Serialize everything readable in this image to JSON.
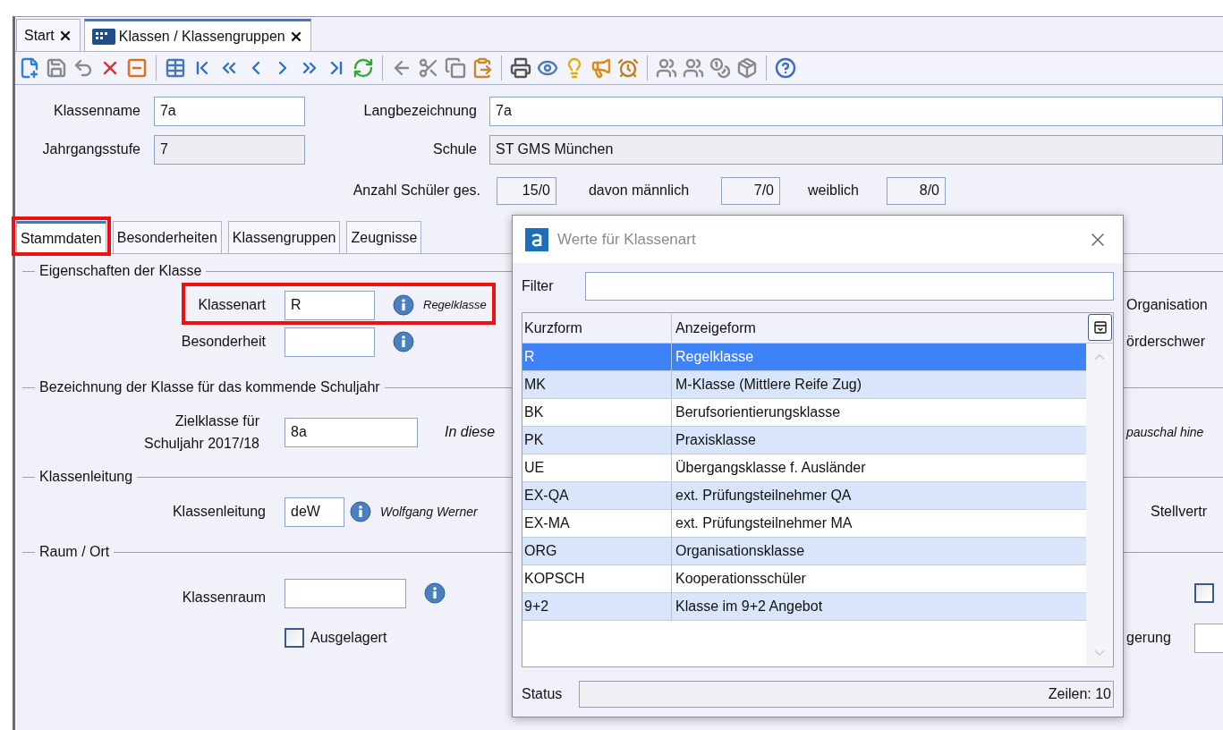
{
  "tabs": [
    {
      "label": "Start",
      "selected": false
    },
    {
      "label": "Klassen / Klassengruppen",
      "selected": true
    }
  ],
  "header_fields": [
    {
      "label": "Klassenname",
      "value": "7a",
      "readonly": false
    },
    {
      "label": "Langbezeichnung",
      "value": "7a",
      "readonly": false
    },
    {
      "label": "Jahrgangsstufe",
      "value": "7",
      "readonly": true
    },
    {
      "label": "Schule",
      "value": "ST GMS München",
      "readonly": true
    }
  ],
  "counts": [
    {
      "label": "Anzahl Schüler ges.",
      "value": "15/0"
    },
    {
      "label": "davon männlich",
      "value": "7/0"
    },
    {
      "label": "weiblich",
      "value": "8/0"
    }
  ],
  "inner_tabs": [
    {
      "label": "Stammdaten",
      "selected": true,
      "highlighted": true
    },
    {
      "label": "Besonderheiten",
      "selected": false,
      "highlighted": false
    },
    {
      "label": "Klassengruppen",
      "selected": false,
      "highlighted": false
    },
    {
      "label": "Zeugnisse",
      "selected": false,
      "highlighted": false
    }
  ],
  "eigenschaften": {
    "title": "Eigenschaften der Klasse",
    "klassenart": {
      "label": "Klassenart",
      "value": "R",
      "description": "Regelklasse",
      "highlighted": true
    },
    "besonderheit": {
      "label": "Besonderheit"
    },
    "right_labels": [
      "Organisation",
      "örderschwer"
    ]
  },
  "kommendes_schuljahr": {
    "title": "Bezeichnung der Klasse für das kommende Schuljahr",
    "label_lines": [
      "Zielklasse für",
      "Schuljahr 2017/18"
    ],
    "value": "8a",
    "note": "In diese",
    "right_note": "pauschal hine"
  },
  "klassenleitung": {
    "title": "Klassenleitung",
    "label": "Klassenleitung",
    "value": "deW",
    "description": "Wolfgang Werner",
    "right_label": "Stellvertr"
  },
  "raum": {
    "title": "Raum / Ort",
    "label": "Klassenraum",
    "ausgelagert": {
      "label": "Ausgelagert",
      "checked": false
    },
    "right_checkbox": {
      "checked": false
    },
    "right_label": "gerung"
  },
  "dialog": {
    "title": "Werte für Klassenart",
    "filter_label": "Filter",
    "columns": [
      "Kurzform",
      "Anzeigeform"
    ],
    "rows": [
      {
        "kurzform": "R",
        "anzeigeform": "Regelklasse",
        "selected": true
      },
      {
        "kurzform": "MK",
        "anzeigeform": "M-Klasse (Mittlere Reife Zug)",
        "selected": false
      },
      {
        "kurzform": "BK",
        "anzeigeform": "Berufsorientierungsklasse",
        "selected": false
      },
      {
        "kurzform": "PK",
        "anzeigeform": "Praxisklasse",
        "selected": false
      },
      {
        "kurzform": "UE",
        "anzeigeform": "Übergangsklasse f. Ausländer",
        "selected": false
      },
      {
        "kurzform": "EX-QA",
        "anzeigeform": "ext. Prüfungsteilnehmer QA",
        "selected": false
      },
      {
        "kurzform": "EX-MA",
        "anzeigeform": "ext. Prüfungsteilnehmer MA",
        "selected": false
      },
      {
        "kurzform": "ORG",
        "anzeigeform": "Organisationsklasse",
        "selected": false
      },
      {
        "kurzform": "KOPSCH",
        "anzeigeform": "Kooperationsschüler",
        "selected": false
      },
      {
        "kurzform": "9+2",
        "anzeigeform": "Klasse im 9+2 Angebot",
        "selected": false
      }
    ],
    "status_label": "Status",
    "status_text": "Zeilen: 10"
  }
}
